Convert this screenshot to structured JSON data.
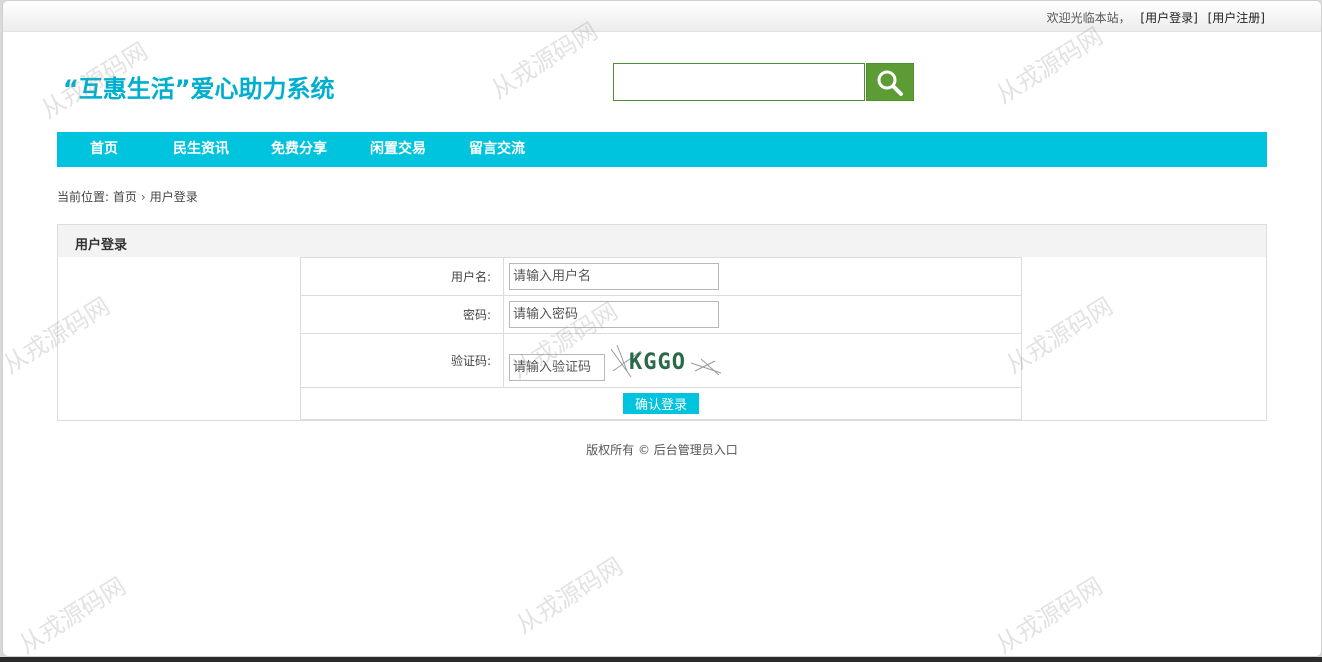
{
  "topbar": {
    "welcome": "欢迎光临本站，",
    "login_link": "[用户登录]",
    "register_link": "[用户注册]"
  },
  "site": {
    "title": "“互惠生活”爱心助力系统"
  },
  "search": {
    "placeholder": "",
    "button_icon": "search-icon"
  },
  "nav": {
    "items": [
      "首页",
      "民生资讯",
      "免费分享",
      "闲置交易",
      "留言交流"
    ]
  },
  "breadcrumb": {
    "prefix": "当前位置:",
    "home": "首页",
    "sep": "›",
    "current": "用户登录"
  },
  "panel": {
    "title": "用户登录",
    "username_label": "用户名:",
    "username_placeholder": "请输入用户名",
    "password_label": "密码:",
    "password_placeholder": "请输入密码",
    "captcha_label": "验证码:",
    "captcha_placeholder": "请输入验证码",
    "captcha_text": "KGGO",
    "submit_label": "确认登录"
  },
  "footer": {
    "text": "版权所有 © 后台管理员入口"
  },
  "watermark": {
    "text": "从戎源码网"
  },
  "colors": {
    "accent": "#00c3dd",
    "title": "#00aecd",
    "search_btn": "#5d9c35"
  }
}
